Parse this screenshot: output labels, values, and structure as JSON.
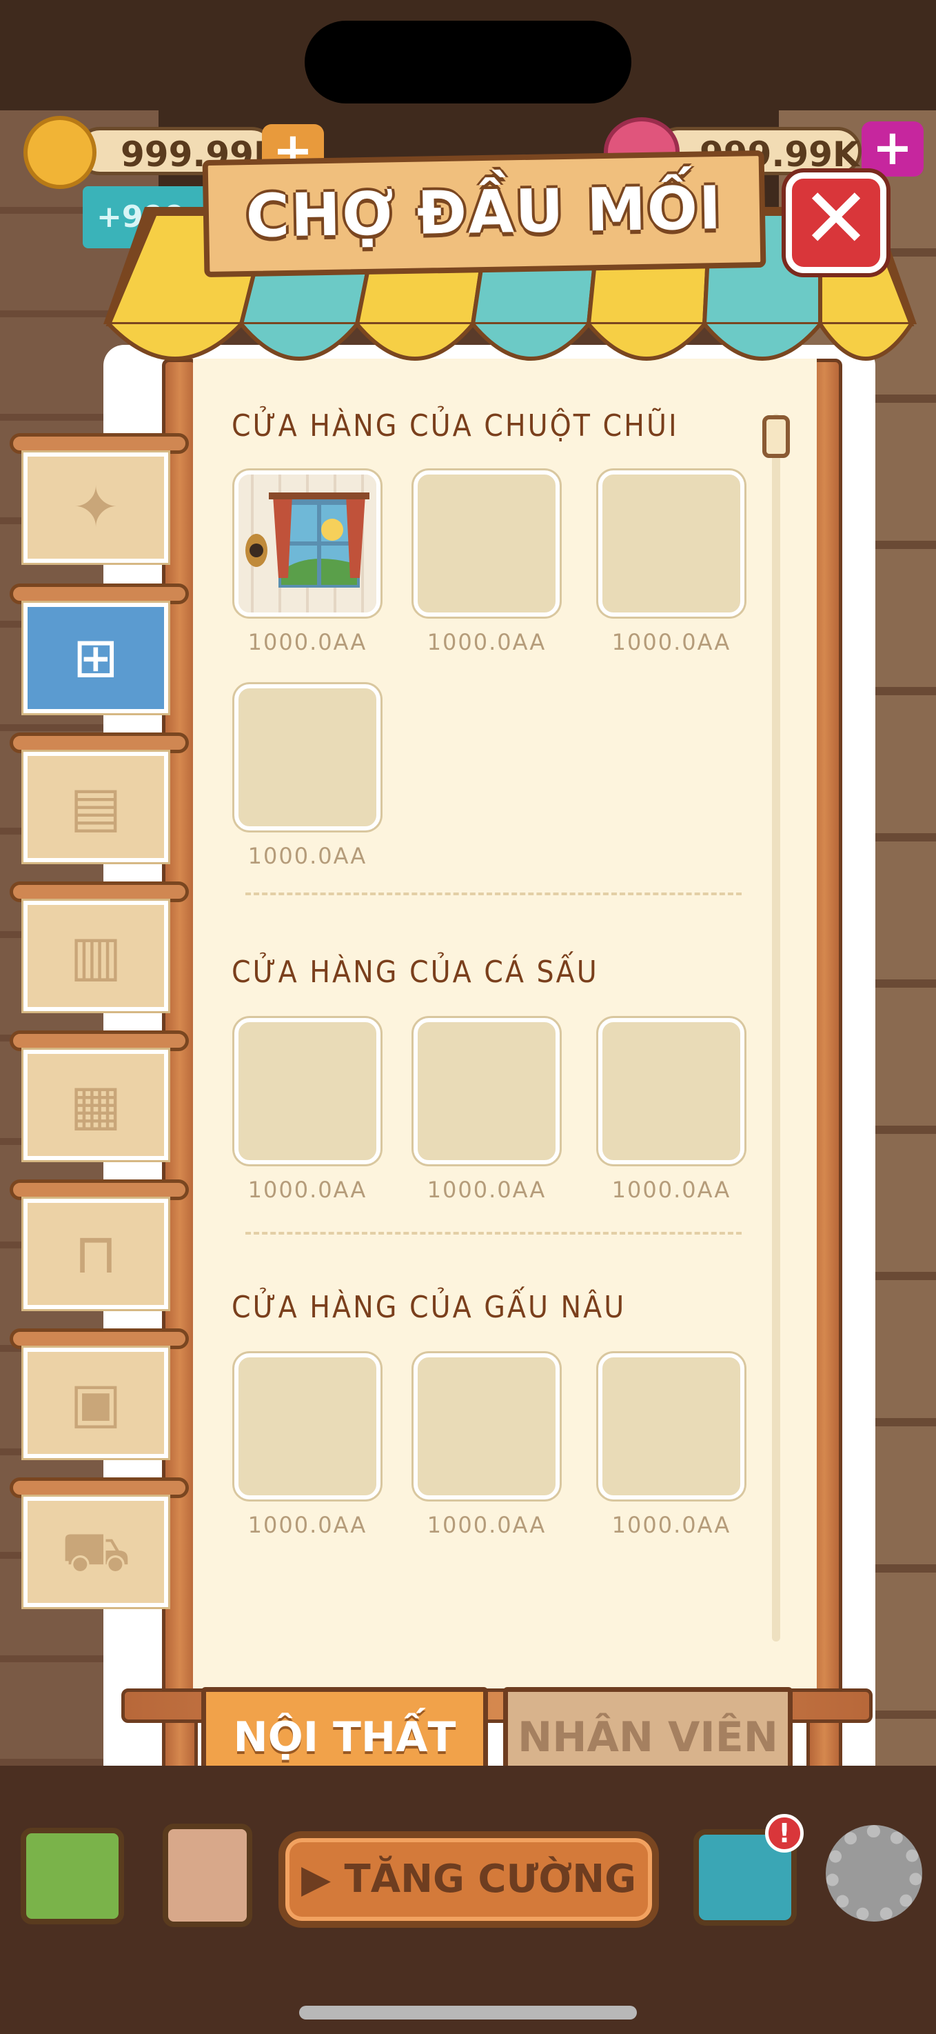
{
  "hud": {
    "coins": "999.99K",
    "gems": "999.99K",
    "bonus": "+999",
    "plus_icon": "plus-icon"
  },
  "panel": {
    "title": "CHỢ ĐẦU MỐI",
    "close_label": "✕"
  },
  "sections": [
    {
      "title": "CỬA HÀNG CỦA CHUỘT CHŨI",
      "items": [
        {
          "price": "1000.0AA",
          "has_image": true
        },
        {
          "price": "1000.0AA",
          "has_image": false
        },
        {
          "price": "1000.0AA",
          "has_image": false
        },
        {
          "price": "1000.0AA",
          "has_image": false
        }
      ]
    },
    {
      "title": "CỬA HÀNG CỦA CÁ SẤU",
      "items": [
        {
          "price": "1000.0AA",
          "has_image": false
        },
        {
          "price": "1000.0AA",
          "has_image": false
        },
        {
          "price": "1000.0AA",
          "has_image": false
        }
      ]
    },
    {
      "title": "CỬA HÀNG CỦA GẤU NÂU",
      "items": [
        {
          "price": "1000.0AA",
          "has_image": false
        },
        {
          "price": "1000.0AA",
          "has_image": false
        },
        {
          "price": "1000.0AA",
          "has_image": false
        }
      ]
    }
  ],
  "sidebar": [
    {
      "icon": "sparkle-icon",
      "glyph": "✦",
      "active": false
    },
    {
      "icon": "window-icon",
      "glyph": "⊞",
      "active": true
    },
    {
      "icon": "cabinet-icon",
      "glyph": "▤",
      "active": false
    },
    {
      "icon": "machine-icon",
      "glyph": "▥",
      "active": false
    },
    {
      "icon": "calendar-gear-icon",
      "glyph": "▦",
      "active": false
    },
    {
      "icon": "counter-icon",
      "glyph": "⊓",
      "active": false
    },
    {
      "icon": "painting-icon",
      "glyph": "▣",
      "active": false
    },
    {
      "icon": "cart-icon",
      "glyph": "⛟",
      "active": false
    }
  ],
  "tabs": {
    "furniture": "NỘI THẤT",
    "staff": "NHÂN VIÊN"
  },
  "bottom": {
    "boost_label": "TĂNG CƯỜNG",
    "shop_icon": "shop-icon",
    "calendar_icon": "calendar-icon",
    "radio_icon": "radio-icon",
    "settings_icon": "gear-icon",
    "alert": "!"
  }
}
